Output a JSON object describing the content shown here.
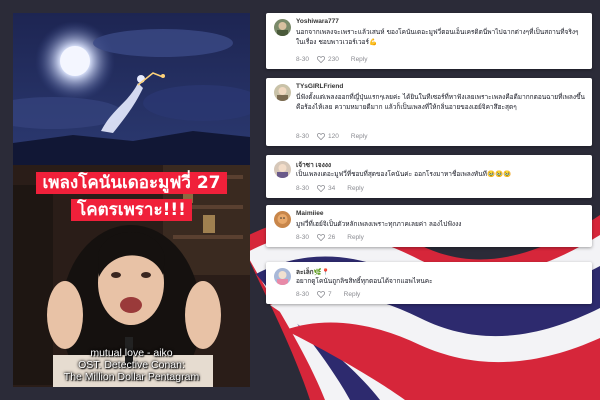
{
  "video": {
    "headline_line1": "เพลงโคนันเดอะมูฟวี่ 27",
    "headline_line2": "โคตรเพราะ!!!",
    "caption_line1": "mutual love - aiko",
    "caption_line2": "OST. Detective Conan:",
    "caption_line3": "The Million Dollar Pentagram"
  },
  "comments": [
    {
      "username": "Yoshiwara777",
      "text": "นอกจากเพลงจะเพราะแล้วเสนห์ ของโคนันเดอะมูฟวี่ตอนเอ็นเครดิตนี่พาไปฉากต่างๆที่เป็นสถานที่จริงๆในเรื่อง ชอบพาวเวอร์เวอร์💪",
      "date": "8-30",
      "likes": "230",
      "reply": "Reply"
    },
    {
      "username": "TYsGIRLFriend",
      "text": "นี่ฟังตั้งแต่เพลงออกที่ญี่ปุ่นแรกๆเลยค่ะ ได้ยินในทีเซอร์ที่หาฟังเลยเพราะเพลงคือดีมากกตอนฉายที่เพลงขึ้นคือร้องไห้เลย ความหมายดีมาก แล้วก็เป็นเพลงที่ให้กลิ่นอายของเฮย์จิคาสึฮะสุดๆ",
      "date": "8-30",
      "likes": "120",
      "reply": "Reply"
    },
    {
      "username": "เจ้าซา เจงงง",
      "text": "เป็นเพลงเดอะมูฟวี่ที่ชอบที่สุดของโคนันค่ะ ออกโรงมาหาชื่อเพลงทันที🥹🥹🥹",
      "date": "8-30",
      "likes": "34",
      "reply": "Reply"
    },
    {
      "username": "Maimiiee",
      "text": "มูฟวี่ที่เฮย์จิเป็นตัวหลักเพลงเพราะทุกภาคเลยค่า ลองไปฟังงง",
      "date": "8-30",
      "likes": "26",
      "reply": "Reply"
    },
    {
      "username": "ละเล็ก🌿📍",
      "text": "อยากดูโคนันถูกลิขสิทธิ์ทุกตอนได้จากแอพไหนคะ",
      "date": "8-30",
      "likes": "7",
      "reply": "Reply"
    }
  ],
  "colors": {
    "background": "#2b2b38",
    "headline_bg": "#f0203a",
    "flag_red": "#d6263a",
    "flag_blue": "#2d2a6e"
  }
}
